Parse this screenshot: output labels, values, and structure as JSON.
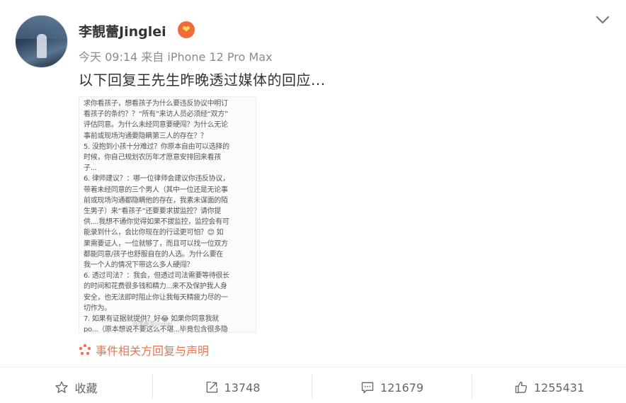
{
  "post": {
    "author": "李靚蕾Jinglei",
    "time": "今天 09:14",
    "source": "来自 iPhone 12 Pro Max",
    "text": "以下回复王先生昨晚透过媒体的回应...",
    "image_text": "求你看孩子，想看孩子为什么要违反协议中明订\n看孩子的条约？？“所有”来访人员必须经“双方”\n评估同意。为什么未经同意要硬闯？为什么无论\n事前或现场沟通要隐瞒第三人的存在？？\n5. 没抱到小孩十分难过？你原本自由可以选择的\n时候，你自己规划农历年才愿意安排回来看孩\n子...\n6. 律师建议？：哪一位律师会建议你违反协议，\n带着未经同意的三个男人（其中一位还是无论事\n前或现场沟通都隐瞒他的存在，我素未谋面的陌\n生男子）来“看孩子”还要要求拔监控？请你提\n供....我想不通你觉得如果不拔监控，监控会有可\n能录到什么，会比你现在的行迳更可怕？😊 如\n果需要证人，一位就够了，而且可以找一位双方\n都能同意/孩子也舒服自在的人选。为什么要在\n我一个人的情况下带这么多人硬闯？\n6. 透过司法？：我会，但透过司法需要等待很长\n的时间和花费很多钱和精力...来不及保护我人身\n安全，也无法即时阻止你让我每天精疲力尽的一\n切作为。\n7. 如果有证据就提供？好😂 如果你同意我就\npo...（原本想说不要这么不堪...毕竟包含很多隐\n私...也不知道什么需要遮蔽什么不需要遮蔽...）。",
    "watermark": "@李靚蕾Jinglei",
    "topic": "事件相关方回复与声明"
  },
  "actions": {
    "favorite": "收藏",
    "repost_count": "13748",
    "comment_count": "121679",
    "like_count": "1255431"
  },
  "icons": {
    "more": "chevron-down-icon",
    "badge": "heart-badge-icon",
    "topic": "topic-dots-icon",
    "favorite": "star-icon",
    "repost": "repost-icon",
    "comment": "comment-icon",
    "like": "thumbs-up-icon"
  },
  "colors": {
    "accent": "#eb7350",
    "text": "#333333",
    "meta": "#8b8b8b"
  }
}
